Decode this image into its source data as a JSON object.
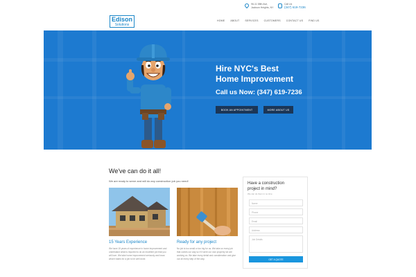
{
  "logo": {
    "main": "Edison",
    "sub": "Solutions"
  },
  "contact": {
    "address_line1": "96-11 58th Ave,",
    "address_line2": "Jackson Heights, NY",
    "phone_label": "Call Us",
    "phone": "(347) 619-7236"
  },
  "nav": {
    "items": [
      {
        "label": "HOME"
      },
      {
        "label": "ABOUT"
      },
      {
        "label": "SERVICES"
      },
      {
        "label": "CUSTOMERS"
      },
      {
        "label": "CONTACT US"
      },
      {
        "label": "FIND US"
      }
    ]
  },
  "hero": {
    "title_line1": "Hire NYC's Best",
    "title_line2": "Home Improvement",
    "call": "Call us Now: (347) 619-7236",
    "btn_appointment": "BOOK AN APPOINTMENT",
    "btn_more": "MORE ABOUT US",
    "accent": "#1d7ad0",
    "button_color": "#1b3657"
  },
  "main": {
    "title": "We've can do it all!",
    "subtitle": "We are ready to serve and will do any construction job you need!",
    "cards": [
      {
        "title": "15 Years Experience",
        "text": "We have 15 years of experience in home improvement and understand what is required to do an excellent job that you will love. We take home improvement seriously and know what it takes for a job to be well done."
      },
      {
        "title": "Ready for any project",
        "text": "No job is too small or too big for us. We take on every job that comes our way so if it were our own property we are working on. We take every detail and consideration and give our all every step of the way."
      }
    ]
  },
  "form": {
    "title_line1": "Have a construction",
    "title_line2": "project in mind?",
    "subtitle": "We can do them in no time",
    "name_placeholder": "Name",
    "phone_placeholder": "Phone",
    "email_placeholder": "Email",
    "address_placeholder": "Address",
    "details_placeholder": "Job Details",
    "submit": "GET A QUOTE"
  }
}
